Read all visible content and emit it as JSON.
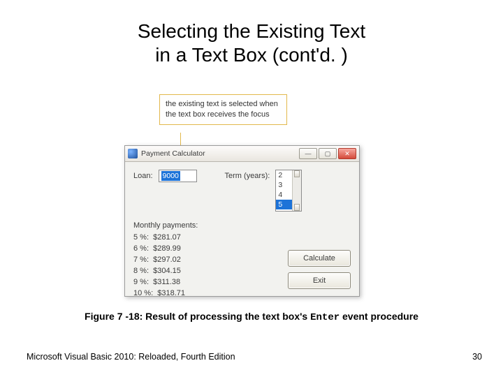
{
  "title_line1": "Selecting the Existing Text",
  "title_line2": "in a Text Box (cont'd. )",
  "callout_text": "the existing text is selected when the text box receives the focus",
  "window": {
    "title": "Payment Calculator",
    "loan_label": "Loan:",
    "loan_value": "9000",
    "term_label": "Term (years):",
    "term_options": [
      "2",
      "3",
      "4",
      "5"
    ],
    "term_selected_index": 3,
    "section_label": "Monthly payments:",
    "payments": [
      "5 %:  $281.07",
      "6 %:  $289.99",
      "7 %:  $297.02",
      "8 %:  $304.15",
      "9 %:  $311.38",
      "10 %:  $318.71"
    ],
    "calc_label": "Calculate",
    "exit_label": "Exit"
  },
  "caption_prefix": "Figure 7 -18: Result of processing the text box's ",
  "caption_code": "Enter",
  "caption_suffix": " event procedure",
  "footer_left": "Microsoft Visual Basic 2010: Reloaded, Fourth Edition",
  "footer_right": "30"
}
